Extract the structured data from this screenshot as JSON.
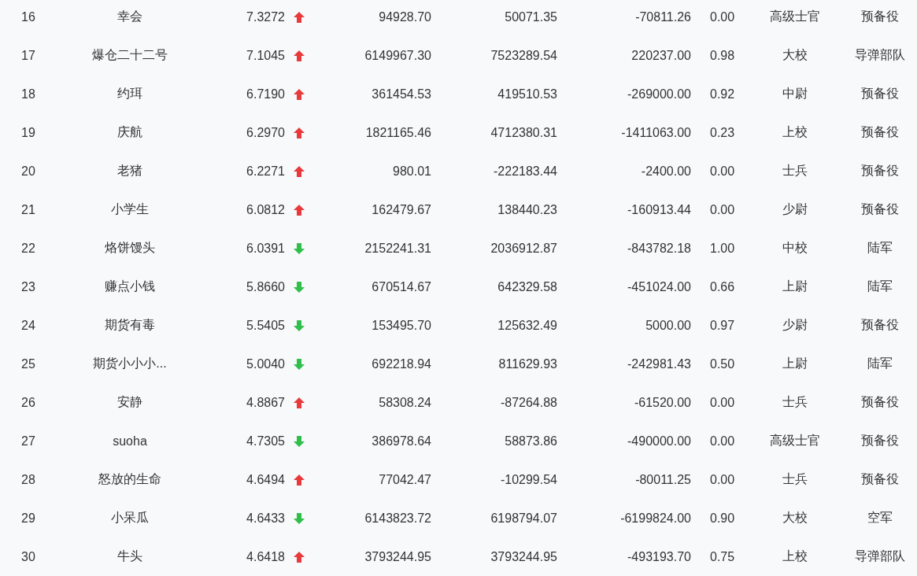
{
  "rows": [
    {
      "rank": "16",
      "name": "幸会",
      "score": "7.3272",
      "rising": true,
      "col_4": "94928.70",
      "col_5": "50071.35",
      "col_6": "-70811.26",
      "col_7": "0.00",
      "rank_title": "高级士官",
      "branch": "预备役"
    },
    {
      "rank": "17",
      "name": "爆仓二十二号",
      "score": "7.1045",
      "rising": true,
      "col_4": "6149967.30",
      "col_5": "7523289.54",
      "col_6": "220237.00",
      "col_7": "0.98",
      "rank_title": "大校",
      "branch": "导弹部队"
    },
    {
      "rank": "18",
      "name": "约珥",
      "score": "6.7190",
      "rising": true,
      "col_4": "361454.53",
      "col_5": "419510.53",
      "col_6": "-269000.00",
      "col_7": "0.92",
      "rank_title": "中尉",
      "branch": "预备役"
    },
    {
      "rank": "19",
      "name": "庆航",
      "score": "6.2970",
      "rising": true,
      "col_4": "1821165.46",
      "col_5": "4712380.31",
      "col_6": "-1411063.00",
      "col_7": "0.23",
      "rank_title": "上校",
      "branch": "预备役"
    },
    {
      "rank": "20",
      "name": "老猪",
      "score": "6.2271",
      "rising": true,
      "col_4": "980.01",
      "col_5": "-222183.44",
      "col_6": "-2400.00",
      "col_7": "0.00",
      "rank_title": "士兵",
      "branch": "预备役"
    },
    {
      "rank": "21",
      "name": "小学生",
      "score": "6.0812",
      "rising": true,
      "col_4": "162479.67",
      "col_5": "138440.23",
      "col_6": "-160913.44",
      "col_7": "0.00",
      "rank_title": "少尉",
      "branch": "预备役"
    },
    {
      "rank": "22",
      "name": "烙饼馒头",
      "score": "6.0391",
      "rising": false,
      "col_4": "2152241.31",
      "col_5": "2036912.87",
      "col_6": "-843782.18",
      "col_7": "1.00",
      "rank_title": "中校",
      "branch": "陆军"
    },
    {
      "rank": "23",
      "name": "赚点小钱",
      "score": "5.8660",
      "rising": false,
      "col_4": "670514.67",
      "col_5": "642329.58",
      "col_6": "-451024.00",
      "col_7": "0.66",
      "rank_title": "上尉",
      "branch": "陆军"
    },
    {
      "rank": "24",
      "name": "期货有毒",
      "score": "5.5405",
      "rising": false,
      "col_4": "153495.70",
      "col_5": "125632.49",
      "col_6": "5000.00",
      "col_7": "0.97",
      "rank_title": "少尉",
      "branch": "预备役"
    },
    {
      "rank": "25",
      "name": "期货小小小...",
      "score": "5.0040",
      "rising": false,
      "col_4": "692218.94",
      "col_5": "811629.93",
      "col_6": "-242981.43",
      "col_7": "0.50",
      "rank_title": "上尉",
      "branch": "陆军"
    },
    {
      "rank": "26",
      "name": "安静",
      "score": "4.8867",
      "rising": true,
      "col_4": "58308.24",
      "col_5": "-87264.88",
      "col_6": "-61520.00",
      "col_7": "0.00",
      "rank_title": "士兵",
      "branch": "预备役"
    },
    {
      "rank": "27",
      "name": "suoha",
      "score": "4.7305",
      "rising": false,
      "col_4": "386978.64",
      "col_5": "58873.86",
      "col_6": "-490000.00",
      "col_7": "0.00",
      "rank_title": "高级士官",
      "branch": "预备役"
    },
    {
      "rank": "28",
      "name": "怒放的生命",
      "score": "4.6494",
      "rising": true,
      "col_4": "77042.47",
      "col_5": "-10299.54",
      "col_6": "-80011.25",
      "col_7": "0.00",
      "rank_title": "士兵",
      "branch": "预备役"
    },
    {
      "rank": "29",
      "name": "小呆瓜",
      "score": "4.6433",
      "rising": false,
      "col_4": "6143823.72",
      "col_5": "6198794.07",
      "col_6": "-6199824.00",
      "col_7": "0.90",
      "rank_title": "大校",
      "branch": "空军"
    },
    {
      "rank": "30",
      "name": "牛头",
      "score": "4.6418",
      "rising": true,
      "col_4": "3793244.95",
      "col_5": "3793244.95",
      "col_6": "-493193.70",
      "col_7": "0.75",
      "rank_title": "上校",
      "branch": "导弹部队"
    }
  ]
}
